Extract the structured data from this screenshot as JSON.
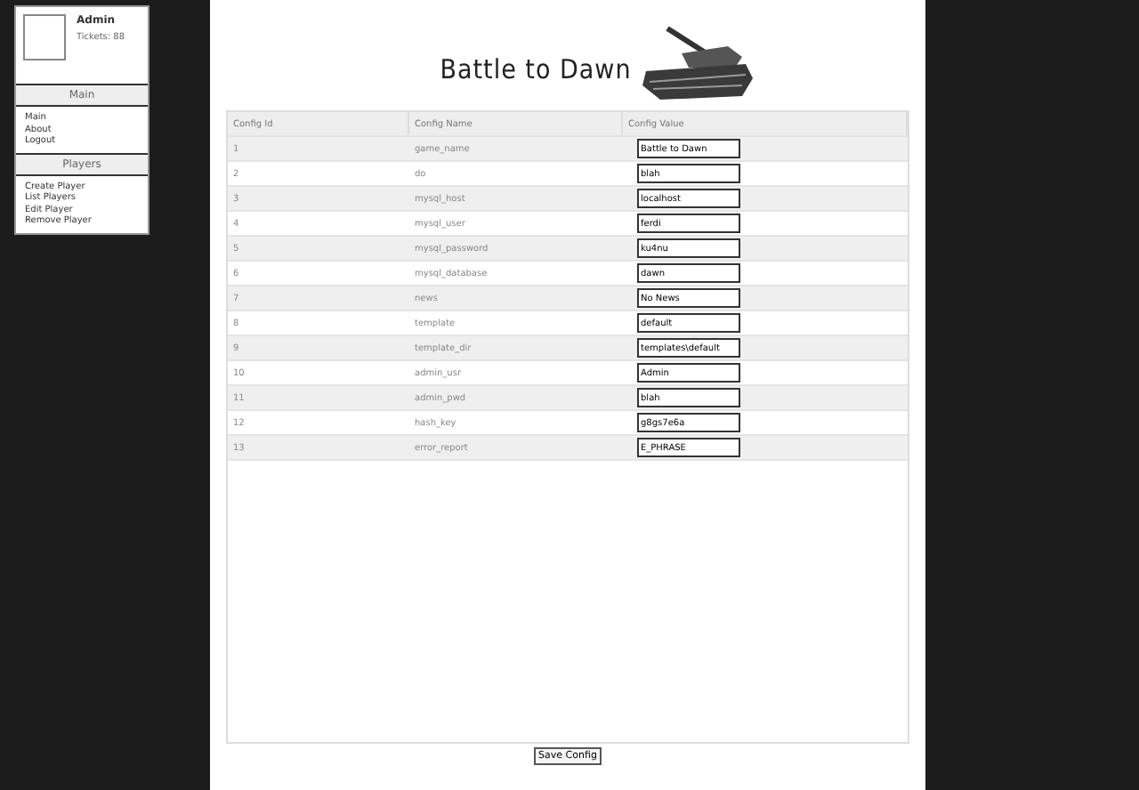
{
  "user": {
    "name": "Admin",
    "tickets": "Tickets: 88"
  },
  "menus": [
    {
      "title": "Main",
      "items": [
        "Main",
        "About",
        "Logout"
      ]
    },
    {
      "title": "Players",
      "items": [
        "Create Player",
        "List Players",
        "Edit Player",
        "Remove Player"
      ]
    }
  ],
  "logo": {
    "title": "Battle to Dawn"
  },
  "table": {
    "columns": [
      "Config Id",
      "Config Name",
      "Config Value"
    ],
    "rows": [
      {
        "id": "1",
        "name": "game_name",
        "value": "Battle to Dawn"
      },
      {
        "id": "2",
        "name": "do",
        "value": "blah"
      },
      {
        "id": "3",
        "name": "mysql_host",
        "value": "localhost"
      },
      {
        "id": "4",
        "name": "mysql_user",
        "value": "ferdi"
      },
      {
        "id": "5",
        "name": "mysql_password",
        "value": "ku4nu"
      },
      {
        "id": "6",
        "name": "mysql_database",
        "value": "dawn"
      },
      {
        "id": "7",
        "name": "news",
        "value": "No News"
      },
      {
        "id": "8",
        "name": "template",
        "value": "default"
      },
      {
        "id": "9",
        "name": "template_dir",
        "value": "templates\\default"
      },
      {
        "id": "10",
        "name": "admin_usr",
        "value": "Admin"
      },
      {
        "id": "11",
        "name": "admin_pwd",
        "value": "blah"
      },
      {
        "id": "12",
        "name": "hash_key",
        "value": "g8gs7e6a"
      },
      {
        "id": "13",
        "name": "error_report",
        "value": "E_PHRASE"
      }
    ]
  },
  "save_button": "Save Config"
}
